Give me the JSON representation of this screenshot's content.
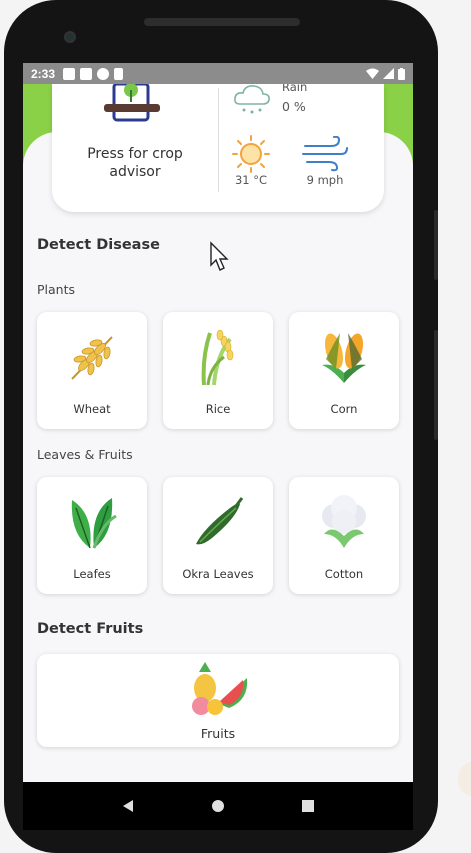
{
  "status_bar": {
    "time": "2:33"
  },
  "advisor": {
    "label": "Press for crop advisor"
  },
  "weather": {
    "rain_label": "Rain",
    "rain_value": "0 %",
    "temperature": "31 °C",
    "wind": "9 mph"
  },
  "detect_disease": {
    "title": "Detect Disease",
    "plants": {
      "title": "Plants",
      "items": [
        {
          "label": "Wheat",
          "icon": "wheat-icon"
        },
        {
          "label": "Rice",
          "icon": "rice-icon"
        },
        {
          "label": "Corn",
          "icon": "corn-icon"
        }
      ]
    },
    "leaves_fruits": {
      "title": "Leaves & Fruits",
      "items": [
        {
          "label": "Leafes",
          "icon": "leaf-icon"
        },
        {
          "label": "Okra Leaves",
          "icon": "okra-icon"
        },
        {
          "label": "Cotton",
          "icon": "cotton-icon"
        }
      ]
    }
  },
  "detect_fruits": {
    "title": "Detect Fruits",
    "item": {
      "label": "Fruits",
      "icon": "fruits-icon"
    }
  },
  "colors": {
    "brand_green": "#8bd147",
    "background": "#f7f7f9",
    "card": "#ffffff"
  }
}
